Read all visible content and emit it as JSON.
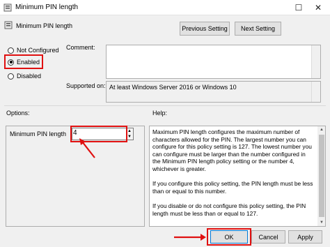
{
  "window": {
    "title": "Minimum PIN length",
    "maximize_glyph": "☐",
    "close_glyph": "✕"
  },
  "header": {
    "policy_name": "Minimum PIN length",
    "previous_label": "Previous Setting",
    "next_label": "Next Setting"
  },
  "state": {
    "options": [
      {
        "label": "Not Configured",
        "checked": false
      },
      {
        "label": "Enabled",
        "checked": true
      },
      {
        "label": "Disabled",
        "checked": false
      }
    ]
  },
  "comment": {
    "label": "Comment:",
    "value": ""
  },
  "supported": {
    "label": "Supported on:",
    "value": "At least Windows Server 2016 or Windows 10"
  },
  "options_section": {
    "label": "Options:",
    "field_label": "Minimum PIN length",
    "field_value": "4"
  },
  "help_section": {
    "label": "Help:",
    "paragraphs": [
      "Maximum PIN length configures the maximum number of characters allowed for the PIN.  The largest number you can configure for this policy setting is 127. The lowest number you can configure must be larger than the number configured in the Minimum PIN length policy setting or the number 4, whichever is greater.",
      "If you configure this policy setting, the PIN length must be less than or equal to this number.",
      "If you disable or do not configure this policy setting, the PIN length must be less than or equal to 127."
    ]
  },
  "footer": {
    "ok_label": "OK",
    "cancel_label": "Cancel",
    "apply_label": "Apply"
  },
  "colors": {
    "highlight": "#e01010",
    "accent": "#0078d7"
  }
}
